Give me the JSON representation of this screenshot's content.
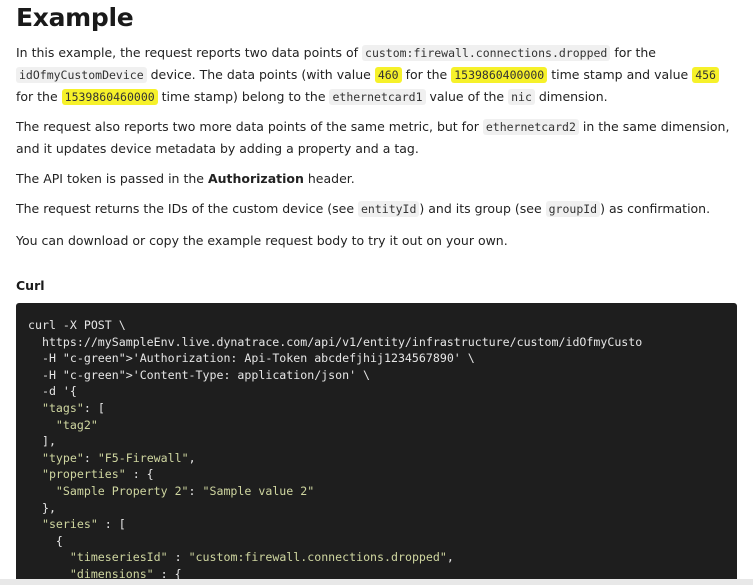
{
  "heading": "Example",
  "para1": {
    "t1": "In this example, the request reports two data points of ",
    "c1": "custom:firewall.connections.dropped",
    "t2": " for the ",
    "c2": "idOfmyCustomDevice",
    "t3": " device. The data points (with value ",
    "v1": "460",
    "t4": " for the ",
    "ts1": "1539860400000",
    "t5": " time stamp and value ",
    "v2": "456",
    "t6": " for the ",
    "ts2": "1539860460000",
    "t7": " time stamp) belong to the ",
    "c3": "ethernetcard1",
    "t8": " value of the ",
    "c4": "nic",
    "t9": " dimension."
  },
  "para2": {
    "t1": "The request also reports two more data points of the same metric, but for ",
    "c1": "ethernetcard2",
    "t2": " in the same dimension, and it updates device metadata by adding a property and a tag."
  },
  "para3": {
    "t1": "The API token is passed in the ",
    "b1": "Authorization",
    "t2": " header."
  },
  "para4": {
    "t1": "The request returns the IDs of the custom device (see ",
    "c1": "entityId",
    "t2": ") and its group (see ",
    "c2": "groupId",
    "t3": ") as confirmation."
  },
  "para5": "You can download or copy the example request body to try it out on your own.",
  "code_heading": "Curl",
  "code_lines": [
    "curl -X POST \\",
    "  https://mySampleEnv.live.dynatrace.com/api/v1/entity/infrastructure/custom/idOfmyCusto",
    "  -H 'Authorization: Api-Token abcdefjhij1234567890' \\",
    "  -H 'Content-Type: application/json' \\",
    "  -d '{",
    "  \"tags\": [",
    "    \"tag2\"",
    "  ],",
    "  \"type\": \"F5-Firewall\",",
    "  \"properties\" : {",
    "    \"Sample Property 2\": \"Sample value 2\"",
    "  },",
    "  \"series\" : [",
    "    {",
    "      \"timeseriesId\" : \"custom:firewall.connections.dropped\",",
    "      \"dimensions\" : {"
  ],
  "colors": {
    "highlight": "#f6f12a",
    "code_background": "#1e1e1e"
  }
}
